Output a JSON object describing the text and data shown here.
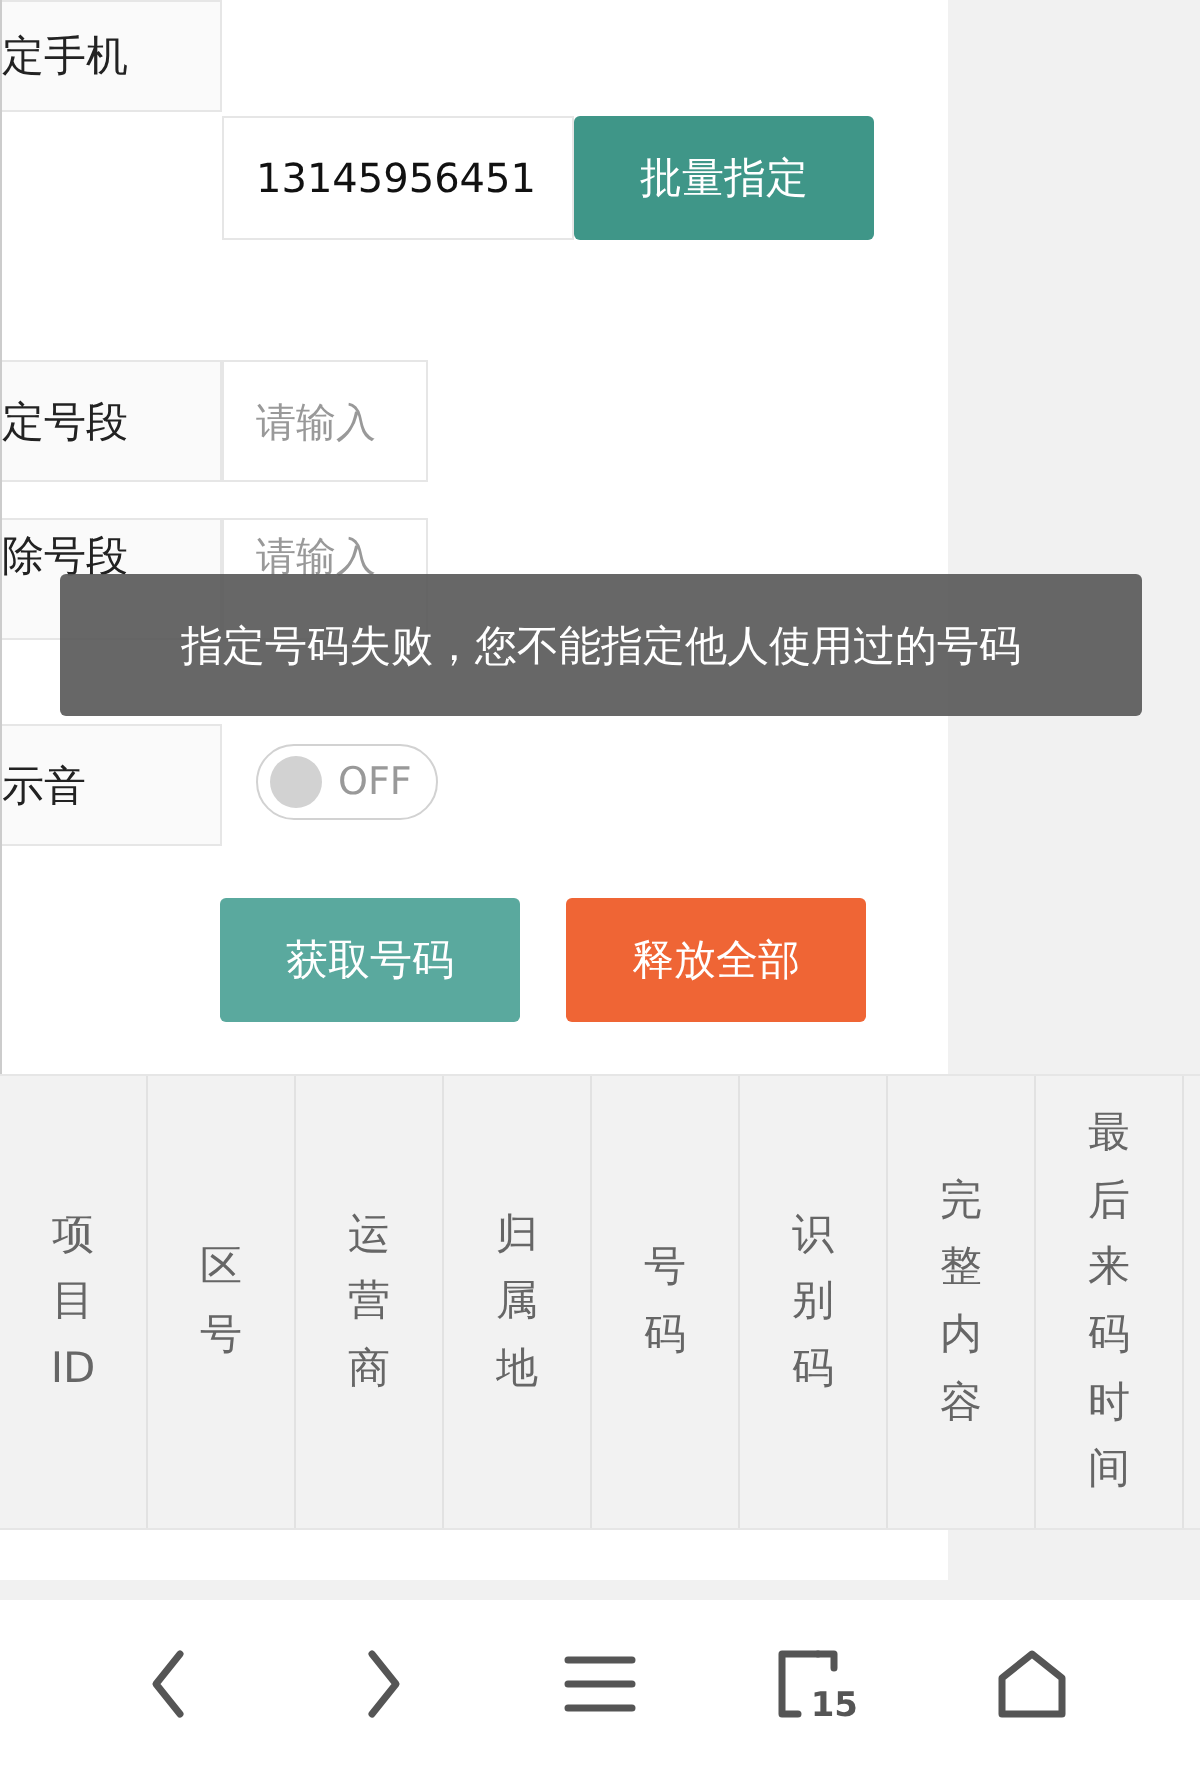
{
  "form": {
    "rows": [
      {
        "kind": "label",
        "label": "定手机"
      },
      {
        "kind": "batch",
        "value": "13145956451",
        "button": "批量指定"
      },
      {
        "kind": "input",
        "label": "定号段",
        "placeholder": "请输入"
      },
      {
        "kind": "input",
        "label": "除号段",
        "placeholder": "请输入"
      },
      {
        "kind": "toggle",
        "label": "示音",
        "on": false,
        "state_text": "OFF"
      }
    ]
  },
  "actions": [
    {
      "label": "获取号码",
      "color": "#5aa99e"
    },
    {
      "label": "释放全部",
      "color": "#ef6535"
    }
  ],
  "table": {
    "columns": [
      "项目ID",
      "区号",
      "运营商",
      "归属地",
      "号码",
      "识别码",
      "完整内容",
      "最后来码时间"
    ]
  },
  "toast": {
    "message": "指定号码失败，您不能指定他人使用过的号码"
  },
  "bottom_bar": {
    "tab_count": "15"
  }
}
